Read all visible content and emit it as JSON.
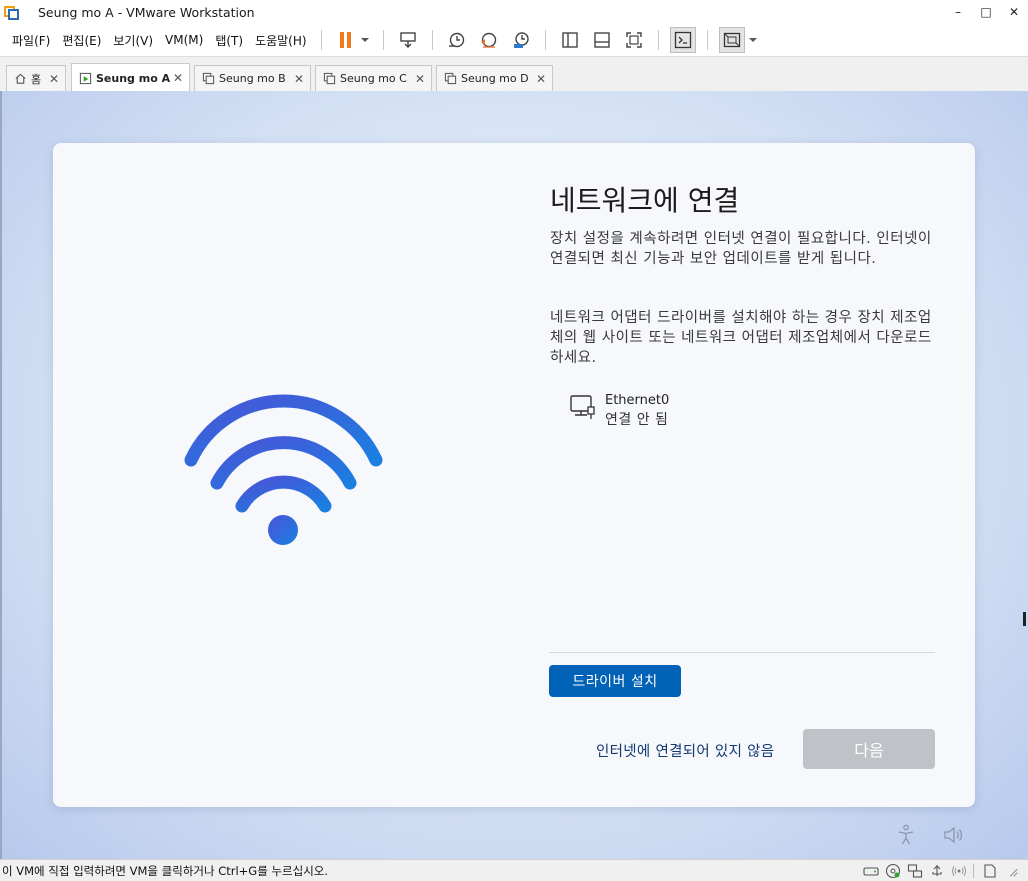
{
  "window": {
    "title": "Seung mo A - VMware Workstation",
    "minimize": "–",
    "maximize": "□",
    "close": "✕"
  },
  "menu": {
    "items": [
      "파일(F)",
      "편집(E)",
      "보기(V)",
      "VM(M)",
      "탭(T)",
      "도움말(H)"
    ]
  },
  "tabs": [
    {
      "label": "홈",
      "icon": "home-icon",
      "active": false
    },
    {
      "label": "Seung mo A",
      "icon": "vm-running-icon",
      "active": true
    },
    {
      "label": "Seung mo B",
      "icon": "vm-icon",
      "active": false
    },
    {
      "label": "Seung mo C",
      "icon": "vm-icon",
      "active": false
    },
    {
      "label": "Seung mo D",
      "icon": "vm-icon",
      "active": false
    }
  ],
  "tab_close": "✕",
  "oobe": {
    "heading": "네트워크에 연결",
    "paragraph1": "장치 설정을 계속하려면 인터넷 연결이 필요합니다. 인터넷이 연결되면 최신 기능과 보안 업데이트를 받게 됩니다.",
    "paragraph2": "네트워크 어댑터 드라이버를 설치해야 하는 경우 장치 제조업체의 웹 사이트 또는 네트워크 어댑터 제조업체에서 다운로드하세요.",
    "adapter": {
      "name": "Ethernet0",
      "status": "연결 안 됨"
    },
    "install_driver_button": "드라이버 설치",
    "no_internet_link": "인터넷에 연결되어 있지 않음",
    "next_button": "다음"
  },
  "colors": {
    "accent": "#0063b8",
    "wifi_gradient_start": "#4a54d8",
    "wifi_gradient_end": "#1a7fe0",
    "disabled_button": "#bfc3c8",
    "pause_orange": "#f07a1c"
  },
  "statusbar": {
    "message": "이 VM에 직접 입력하려면 VM을 클릭하거나 Ctrl+G를 누르십시오."
  }
}
